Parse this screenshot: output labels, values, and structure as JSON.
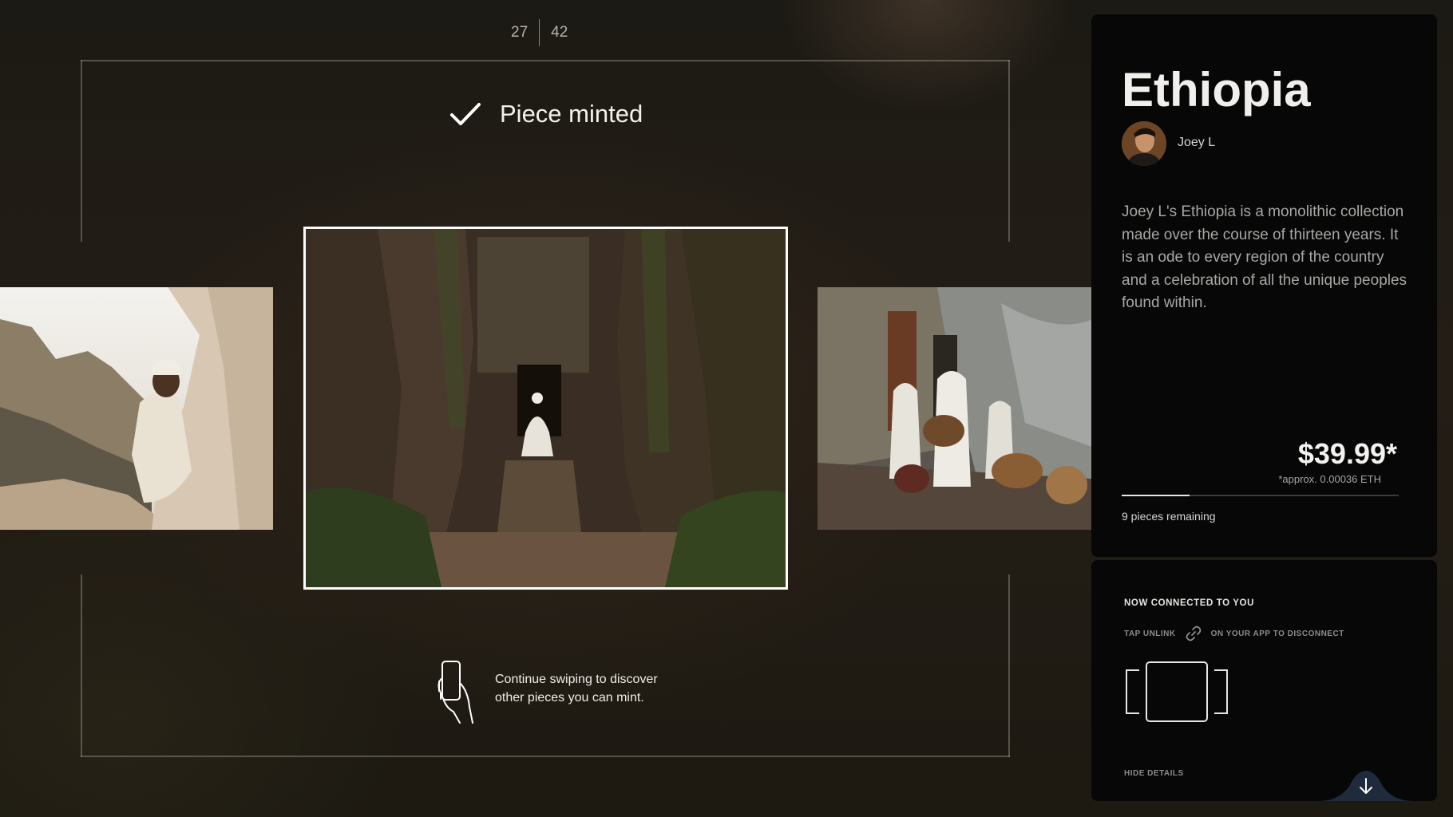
{
  "counter": {
    "current": "27",
    "total": "42"
  },
  "status": {
    "label": "Piece minted",
    "icon": "checkmark-icon"
  },
  "hint": {
    "line1": "Continue swiping to discover",
    "line2": "other pieces you can mint.",
    "icon": "phone-swipe-icon"
  },
  "gallery": {
    "left": "man-leaning-on-rock-photo",
    "center": "rock-church-passage-photo",
    "right": "drummers-at-wall-photo"
  },
  "details": {
    "title": "Ethiopia",
    "artist": "Joey L",
    "description": "Joey L's Ethiopia is a monolithic collection made over the course of thirteen years. It is an ode to every region of the country and a celebration of all the unique peoples found within.",
    "price": "$39.99*",
    "approx": "*approx. 0.00036 ETH",
    "progress_fraction": 0.245,
    "remaining": "9 pieces remaining"
  },
  "connection": {
    "heading": "NOW CONNECTED TO YOU",
    "tap": "TAP UNLINK",
    "suffix": "ON YOUR APP TO DISCONNECT",
    "hide": "HIDE DETAILS"
  },
  "colors": {
    "panel_bg": "#070707",
    "accent_tab": "#1f2a3d",
    "text_muted": "#a9a7a3"
  }
}
